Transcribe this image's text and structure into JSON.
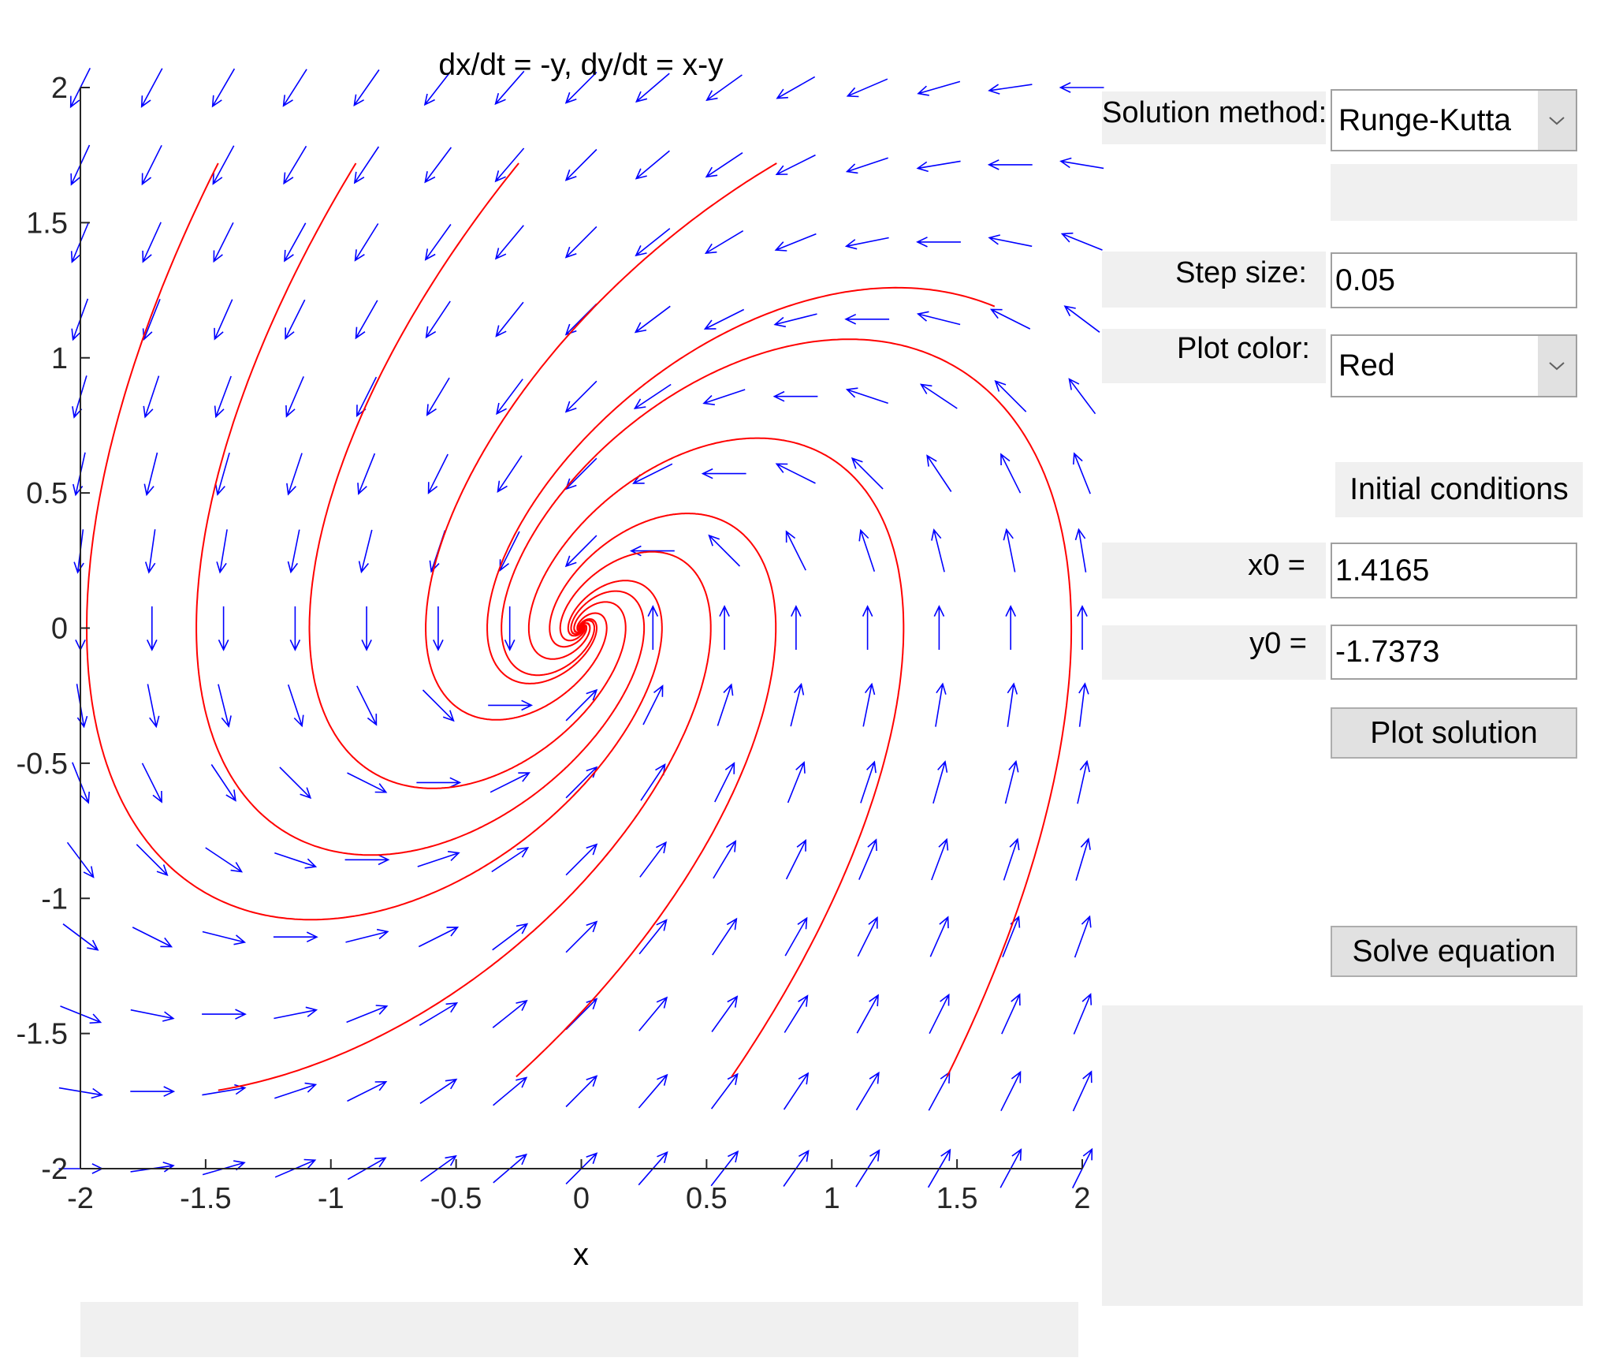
{
  "chart_data": {
    "type": "direction-field",
    "title": "dx/dt = -y, dy/dt = x-y",
    "xlabel": "x",
    "ylabel": "",
    "xlim": [
      -2,
      2
    ],
    "ylim": [
      -2,
      2
    ],
    "xticks": [
      "-2",
      "-1.5",
      "-1",
      "-0.5",
      "0",
      "0.5",
      "1",
      "1.5",
      "2"
    ],
    "yticks": [
      "-2",
      "-1.5",
      "-1",
      "-0.5",
      "0",
      "0.5",
      "1",
      "1.5",
      "2"
    ],
    "field_color": "#0000ff",
    "solution_color": "#ff0000",
    "solution_starts": [
      [
        -1.45,
        1.72
      ],
      [
        -0.9,
        1.72
      ],
      [
        -0.25,
        1.72
      ],
      [
        0.78,
        1.72
      ],
      [
        1.65,
        1.19
      ],
      [
        -1.45,
        -1.71
      ],
      [
        -0.26,
        -1.66
      ],
      [
        0.6,
        -1.66
      ],
      [
        1.46,
        -1.66
      ]
    ]
  },
  "controls": {
    "solution_method_label": "Solution method:",
    "solution_method_value": "Runge-Kutta",
    "step_size_label": "Step size:",
    "step_size_value": "0.05",
    "plot_color_label": "Plot color:",
    "plot_color_value": "Red",
    "initial_conditions_title": "Initial conditions",
    "x0_label": "x0 =",
    "x0_value": "1.4165",
    "y0_label": "y0 =",
    "y0_value": "-1.7373",
    "plot_button": "Plot solution",
    "solve_button": "Solve equation"
  }
}
